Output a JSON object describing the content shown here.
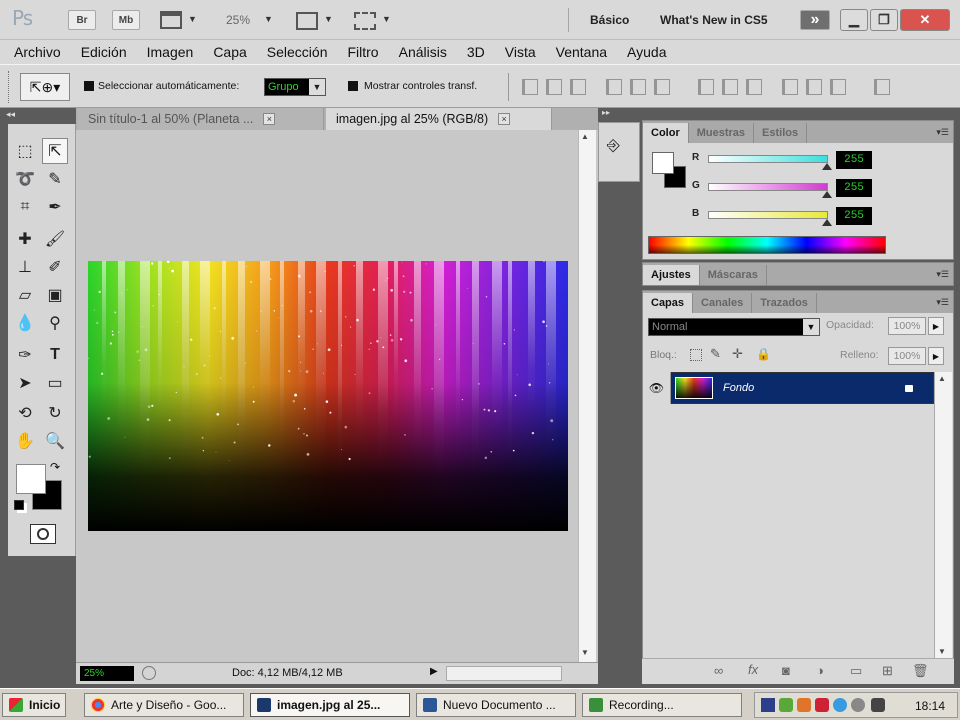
{
  "titlebar": {
    "logo": "Ps",
    "br_label": "Br",
    "mb_label": "Mb",
    "zoom": "25%",
    "workspace_basic": "Básico",
    "workspace_new": "What's New in CS5",
    "expand_glyph": "»"
  },
  "menu": [
    "Archivo",
    "Edición",
    "Imagen",
    "Capa",
    "Selección",
    "Filtro",
    "Análisis",
    "3D",
    "Vista",
    "Ventana",
    "Ayuda"
  ],
  "options": {
    "auto_select_label": "Seleccionar automáticamente:",
    "auto_select_value": "Grupo",
    "show_transform_label": "Mostrar controles transf."
  },
  "documents": {
    "tab1": "Sin título-1 al 50% (Planeta ...",
    "tab2": "imagen.jpg al 25% (RGB/8)",
    "close_glyph": "×"
  },
  "status": {
    "zoom": "25%",
    "doc_info": "Doc: 4,12 MB/4,12 MB"
  },
  "color_panel": {
    "tabs": [
      "Color",
      "Muestras",
      "Estilos"
    ],
    "labels": [
      "R",
      "G",
      "B"
    ],
    "values": [
      "255",
      "255",
      "255"
    ],
    "slider_colors": [
      "#3cdede",
      "#d23ad2",
      "#e8e83a"
    ]
  },
  "adjust_panel": {
    "tabs": [
      "Ajustes",
      "Máscaras"
    ]
  },
  "layers_panel": {
    "tabs": [
      "Capas",
      "Canales",
      "Trazados"
    ],
    "blend_mode": "Normal",
    "opacity_label": "Opacidad:",
    "opacity_value": "100%",
    "lock_label": "Bloq.:",
    "fill_label": "Relleno:",
    "fill_value": "100%",
    "layer_name": "Fondo"
  },
  "taskbar": {
    "start": "Inicio",
    "tasks": [
      "Arte y Diseño - Goo...",
      "imagen.jpg al 25...",
      "Nuevo Documento ...",
      "Recording..."
    ],
    "clock": "18:14"
  }
}
